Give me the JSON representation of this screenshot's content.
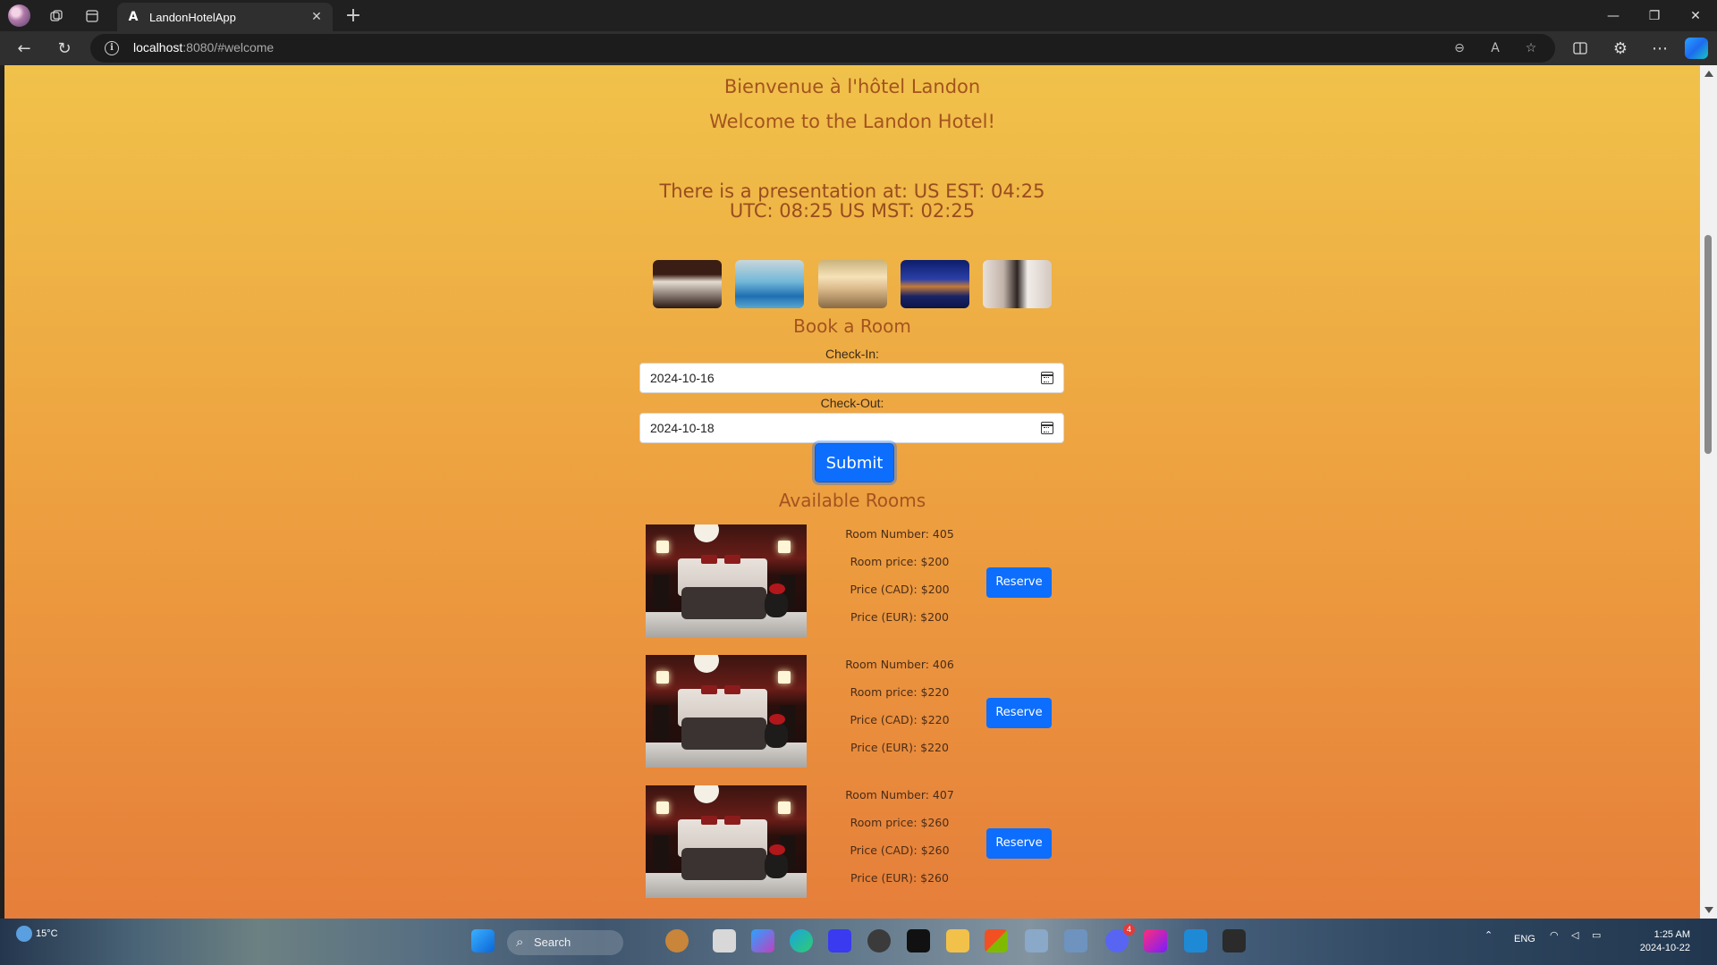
{
  "browser": {
    "tab_title": "LandonHotelApp",
    "url_host": "localhost",
    "url_rest": ":8080/#welcome"
  },
  "page": {
    "heading_fr": "Bienvenue à l'hôtel Landon",
    "heading_en": "Welcome to the Landon Hotel!",
    "presentation": "There is a presentation at: US EST: 04:25 UTC: 08:25 US MST: 02:25",
    "book_title": "Book a Room",
    "checkin_label": "Check-In:",
    "checkin_value": "2024-10-16",
    "checkout_label": "Check-Out:",
    "checkout_value": "2024-10-18",
    "submit_label": "Submit",
    "available_title": "Available Rooms",
    "rooms": [
      {
        "number": "Room Number: 405",
        "price": "Room price: $200",
        "cad": "Price (CAD): $200",
        "eur": "Price (EUR): $200",
        "reserve": "Reserve"
      },
      {
        "number": "Room Number: 406",
        "price": "Room price: $220",
        "cad": "Price (CAD): $220",
        "eur": "Price (EUR): $220",
        "reserve": "Reserve"
      },
      {
        "number": "Room Number: 407",
        "price": "Room price: $260",
        "cad": "Price (CAD): $260",
        "eur": "Price (EUR): $260",
        "reserve": "Reserve"
      }
    ]
  },
  "taskbar": {
    "weather": "15°C",
    "search": "Search",
    "lang": "ENG",
    "time": "1:25 AM",
    "date": "2024-10-22",
    "discord_badge": "4"
  },
  "colors": {
    "accent": "#0d6efd",
    "heading": "#a4531f",
    "bg_top": "#f0c24a",
    "bg_bottom": "#e57e3a"
  }
}
